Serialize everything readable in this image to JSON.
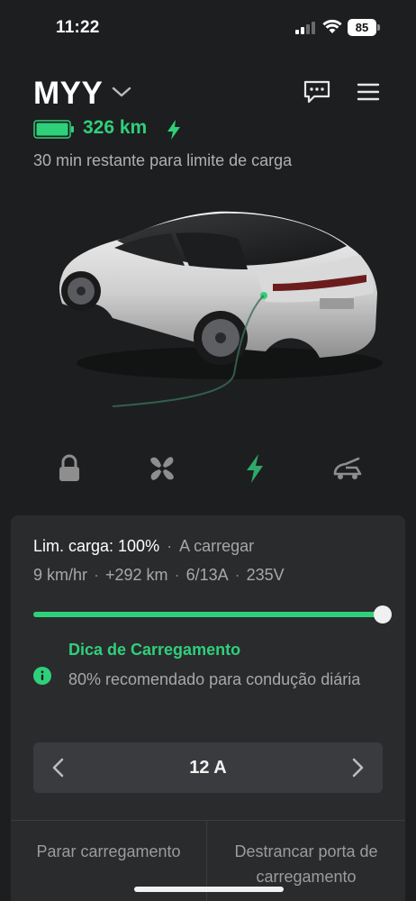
{
  "status_bar": {
    "time": "11:22",
    "battery_percent": "85",
    "signal_bars_active": 2,
    "signal_bars_total": 4
  },
  "header": {
    "vehicle_name": "MYY",
    "icons": [
      "chevron-down-icon",
      "message-icon",
      "menu-icon"
    ]
  },
  "charge_summary": {
    "range": "326 km",
    "status_text": "30 min restante para limite de carga",
    "accent_color": "#2fd07a"
  },
  "quick_actions": [
    {
      "icon": "lock-icon",
      "active": false
    },
    {
      "icon": "fan-icon",
      "active": false
    },
    {
      "icon": "bolt-icon",
      "active": true
    },
    {
      "icon": "trunk-icon",
      "active": false
    }
  ],
  "charge_panel": {
    "limit_label": "Lim. carga: 100%",
    "separator": "·",
    "charging_state": "A carregar",
    "stats": [
      "9 km/hr",
      "+292 km",
      "6/13A",
      "235V"
    ],
    "limit_fraction": 1.0,
    "tip": {
      "title": "Dica de Carregamento",
      "text": "80% recomendado para condução diária"
    },
    "amperage": "12 A",
    "buttons": {
      "stop": "Parar carregamento",
      "unlock_port": "Destrancar porta de carregamento"
    }
  }
}
